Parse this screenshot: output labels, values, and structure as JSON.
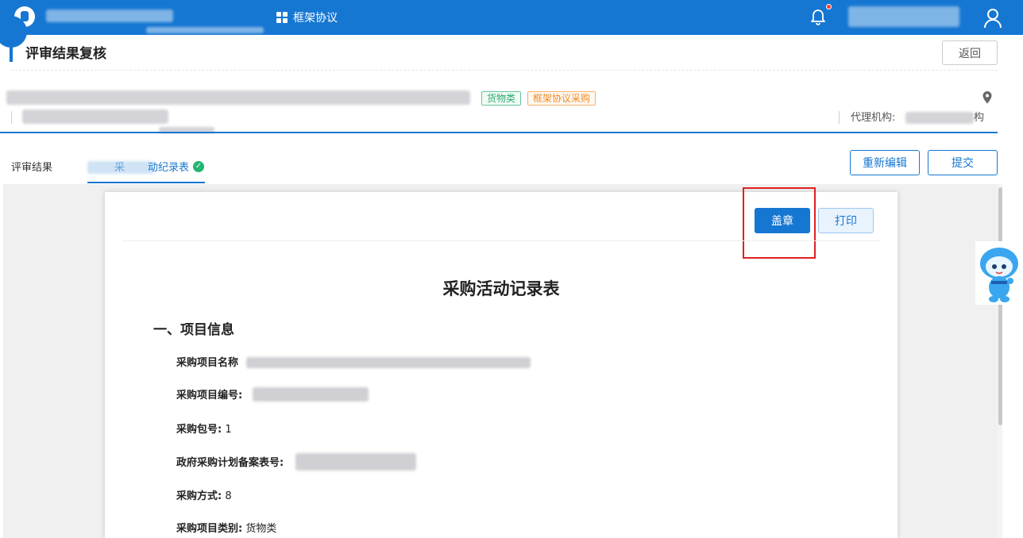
{
  "header": {
    "nav_label": "框架协议"
  },
  "page": {
    "title": "评审结果复核",
    "back_label": "返回"
  },
  "project": {
    "tags": [
      "货物类",
      "框架协议采购"
    ],
    "agency_label": "代理机构:",
    "agency_suffix": "构"
  },
  "tabs": [
    {
      "label": "评审结果"
    },
    {
      "label_visible": "动纪录表",
      "prefix_visible": "采"
    }
  ],
  "actions": {
    "reedit_label": "重新编辑",
    "submit_label": "提交"
  },
  "document": {
    "stamp_label": "盖章",
    "print_label": "打印",
    "title": "采购活动记录表",
    "section1_title": "一、项目信息",
    "fields": [
      {
        "label": "采购项目名称",
        "value": ""
      },
      {
        "label": "采购项目编号:",
        "value": ""
      },
      {
        "label": "采购包号:",
        "value": "1"
      },
      {
        "label": "政府采购计划备案表号:",
        "value": ""
      },
      {
        "label": "采购方式:",
        "value": "8"
      },
      {
        "label": "采购项目类别:",
        "value": "货物类"
      }
    ]
  },
  "colors": {
    "primary": "#1677d2",
    "highlight": "#e02020",
    "tag_goods": "#2da86f",
    "tag_frame": "#f08a24"
  }
}
